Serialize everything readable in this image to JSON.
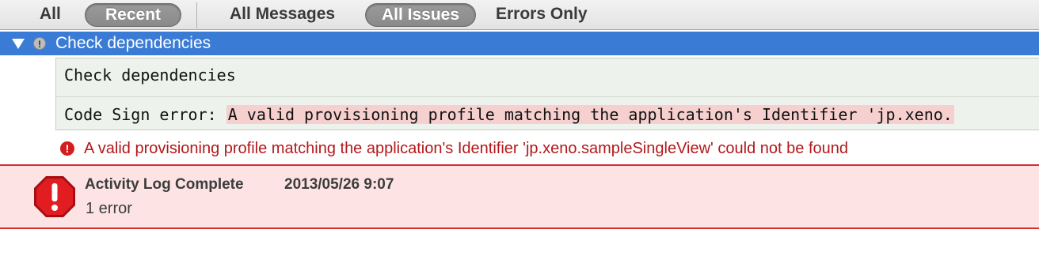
{
  "filters": {
    "scope": [
      {
        "label": "All",
        "selected": false
      },
      {
        "label": "Recent",
        "selected": true
      }
    ],
    "type": [
      {
        "label": "All Messages",
        "selected": false
      },
      {
        "label": "All Issues",
        "selected": true
      },
      {
        "label": "Errors Only",
        "selected": false
      }
    ]
  },
  "group": {
    "title": "Check dependencies",
    "expanded": true,
    "icon": "info-icon"
  },
  "transcript": {
    "line1": "Check dependencies",
    "line2_prefix": "Code Sign error:",
    "line2_highlight": "A valid provisioning profile matching the application's Identifier 'jp.xeno."
  },
  "error": {
    "icon": "error-icon",
    "message": "A valid provisioning profile matching the application's Identifier 'jp.xeno.sampleSingleView' could not be found"
  },
  "activity": {
    "icon": "stop-sign-icon",
    "title": "Activity Log Complete",
    "timestamp": "2013/05/26 9:07",
    "summary": "1 error"
  },
  "colors": {
    "selection_blue": "#3a7bd6",
    "error_red": "#d11f1f",
    "error_text": "#b3181b",
    "activity_bg": "#fde3e4",
    "transcript_bg": "#eef2ec",
    "highlight": "#f6cfcf"
  }
}
